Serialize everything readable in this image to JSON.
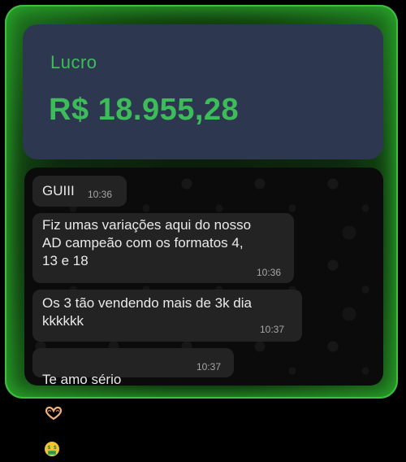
{
  "lucro": {
    "label": "Lucro",
    "value": "R$ 18.955,28"
  },
  "colors": {
    "accent_green": "#3dbd59",
    "panel_bg": "#2d3850",
    "bubble_bg": "#232323",
    "frame_glow": "#3fbf3f"
  },
  "chat": {
    "messages": [
      {
        "text": "GUIII",
        "time": "10:36"
      },
      {
        "text": "Fiz umas variações aqui do nosso\nAD campeão com os formatos 4,\n13 e 18",
        "time": "10:36"
      },
      {
        "text": "Os 3 tão vendendo mais de 3k dia\nkkkkkk",
        "time": "10:37"
      },
      {
        "text": "Te amo sério",
        "time": "10:37",
        "emojis": [
          "heart-hands-icon",
          "money-mouth-face-icon"
        ]
      }
    ]
  }
}
